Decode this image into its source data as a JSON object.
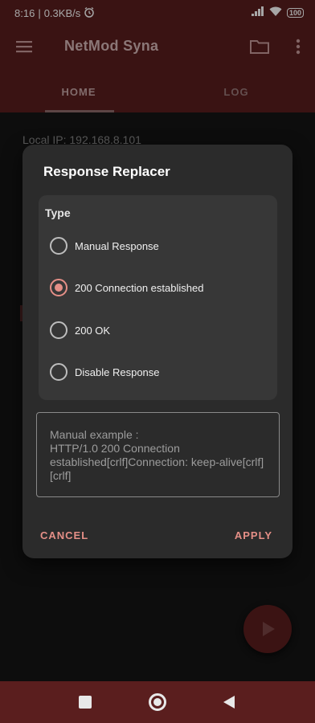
{
  "status_bar": {
    "time": "8:16",
    "separator": "|",
    "network_speed": "0.3KB/s",
    "alarm_icon": "alarm-icon",
    "signal_icon": "signal-icon",
    "wifi_icon": "wifi-icon",
    "battery_level": "100"
  },
  "app_bar": {
    "title": "NetMod Syna",
    "menu_icon": "hamburger-menu-icon",
    "folder_icon": "folder-icon",
    "more_icon": "more-vertical-icon"
  },
  "tabs": [
    {
      "label": "HOME",
      "selected": true
    },
    {
      "label": "LOG",
      "selected": false
    }
  ],
  "main": {
    "local_ip": "Local IP: 192.168.8.101"
  },
  "dialog": {
    "title": "Response Replacer",
    "type_label": "Type",
    "options": [
      {
        "label": "Manual Response",
        "checked": false
      },
      {
        "label": "200 Connection established",
        "checked": true
      },
      {
        "label": "200 OK",
        "checked": false
      },
      {
        "label": "Disable Response",
        "checked": false
      }
    ],
    "example_placeholder": "Manual example :\nHTTP/1.0 200 Connection established[crlf]Connection: keep-alive[crlf][crlf]",
    "cancel_label": "CANCEL",
    "apply_label": "APPLY"
  },
  "fab": {
    "icon": "play-icon"
  },
  "nav_bar": {
    "recents_icon": "square-recents-icon",
    "home_icon": "circle-home-icon",
    "back_icon": "triangle-back-icon"
  },
  "colors": {
    "primary": "#5a1e1e",
    "accent": "#e58f87",
    "dialog_bg": "#2b2b2b"
  }
}
